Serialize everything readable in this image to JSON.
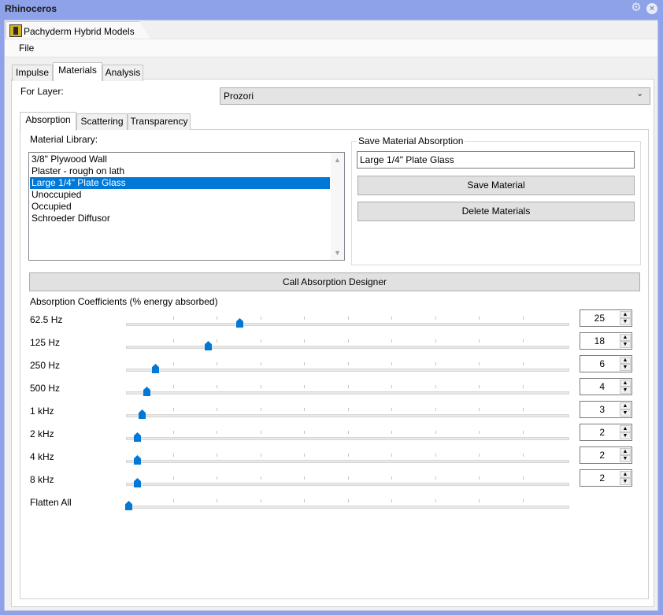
{
  "window": {
    "title": "Rhinoceros"
  },
  "panel": {
    "title": "Pachyderm Hybrid Models"
  },
  "menu": {
    "file": "File"
  },
  "tabs": {
    "items": [
      "Impulse",
      "Materials",
      "Analysis"
    ],
    "active": "Materials"
  },
  "layer": {
    "label": "For Layer:",
    "value": "Prozori"
  },
  "subtabs": {
    "items": [
      "Absorption",
      "Scattering",
      "Transparency"
    ],
    "active": "Absorption"
  },
  "library": {
    "label": "Material Library:",
    "items": [
      "3/8\" Plywood Wall",
      "Plaster - rough on lath",
      "Large 1/4\" Plate Glass",
      "Unoccupied",
      "Occupied",
      "Schroeder Diffusor"
    ],
    "selected_index": 2
  },
  "save_group": {
    "label": "Save Material Absorption",
    "name_value": "Large 1/4\" Plate Glass",
    "save_button": "Save Material",
    "delete_button": "Delete Materials"
  },
  "designer_button": "Call Absorption Designer",
  "coefficients": {
    "label": "Absorption Coefficients (% energy absorbed)",
    "max": 100,
    "bands": [
      {
        "label": "62.5 Hz",
        "value": "25"
      },
      {
        "label": "125 Hz",
        "value": "18"
      },
      {
        "label": "250 Hz",
        "value": "6"
      },
      {
        "label": "500 Hz",
        "value": "4"
      },
      {
        "label": "1 kHz",
        "value": "3"
      },
      {
        "label": "2 kHz",
        "value": "2"
      },
      {
        "label": "4 kHz",
        "value": "2"
      },
      {
        "label": "8 kHz",
        "value": "2"
      }
    ],
    "flatten": {
      "label": "Flatten All",
      "value": 0
    }
  },
  "colors": {
    "accent": "#0078d7",
    "titlebar": "#8da2e8"
  }
}
